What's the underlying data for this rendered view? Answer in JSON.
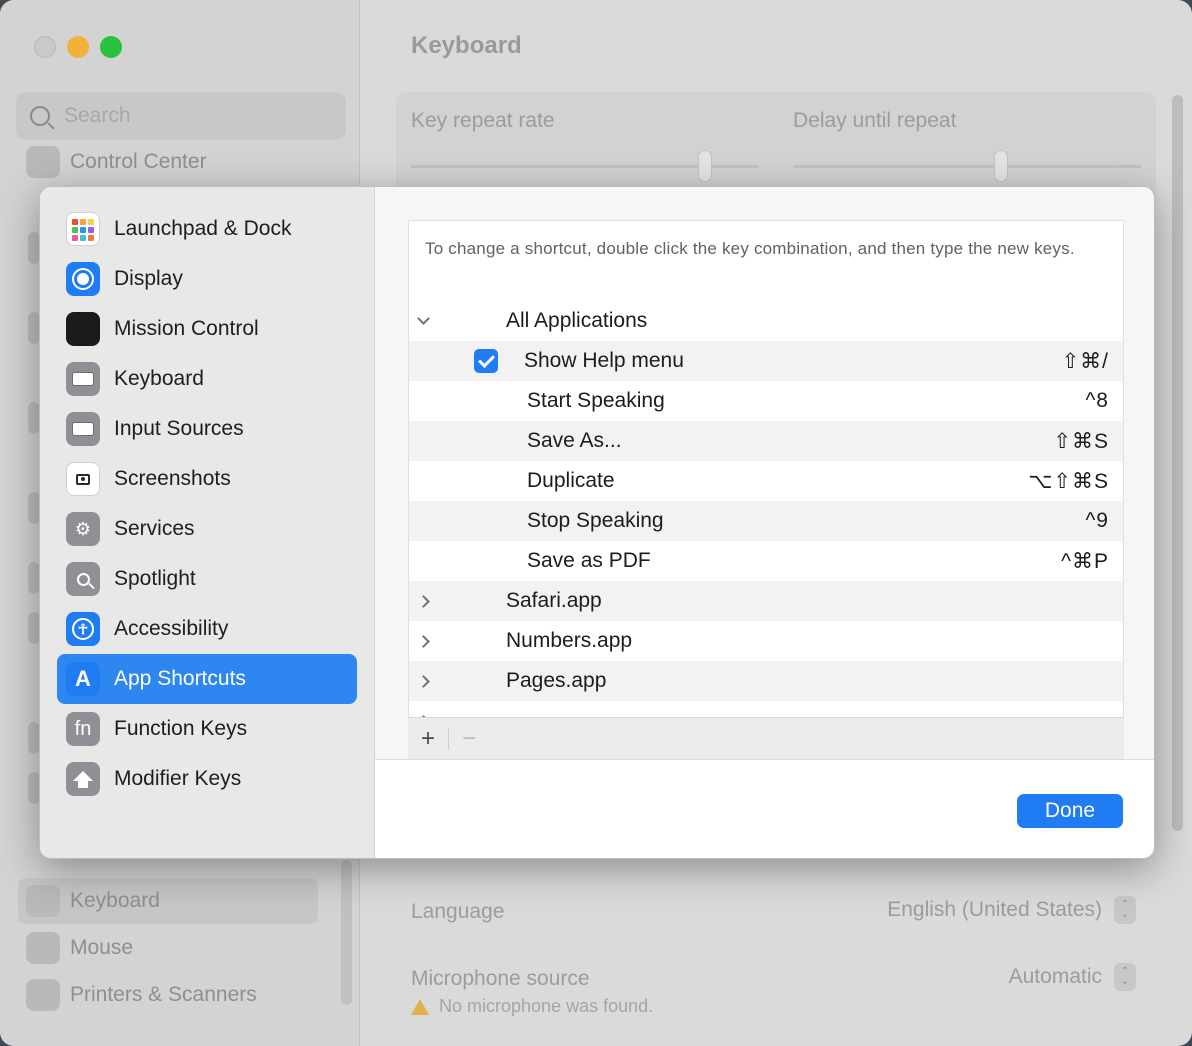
{
  "background": {
    "search_placeholder": "Search",
    "sidebar_top_item": "Control Center",
    "sidebar_bottom_items": [
      "Keyboard",
      "Mouse",
      "Printers & Scanners"
    ],
    "page_title": "Keyboard",
    "key_repeat_label": "Key repeat rate",
    "delay_label": "Delay until repeat",
    "language_label": "Language",
    "language_value": "English (United States)",
    "mic_label": "Microphone source",
    "mic_value": "Automatic",
    "mic_warning": "No microphone was found."
  },
  "sheet": {
    "sidebar": [
      {
        "label": "Launchpad & Dock",
        "icon": "launchpad-icon"
      },
      {
        "label": "Display",
        "icon": "display-icon"
      },
      {
        "label": "Mission Control",
        "icon": "mission-control-icon"
      },
      {
        "label": "Keyboard",
        "icon": "keyboard-icon"
      },
      {
        "label": "Input Sources",
        "icon": "input-sources-icon"
      },
      {
        "label": "Screenshots",
        "icon": "screenshots-icon"
      },
      {
        "label": "Services",
        "icon": "services-gear-icon"
      },
      {
        "label": "Spotlight",
        "icon": "spotlight-icon"
      },
      {
        "label": "Accessibility",
        "icon": "accessibility-icon"
      },
      {
        "label": "App Shortcuts",
        "icon": "app-shortcuts-icon"
      },
      {
        "label": "Function Keys",
        "icon": "function-keys-icon"
      },
      {
        "label": "Modifier Keys",
        "icon": "modifier-keys-icon"
      }
    ],
    "selected_item": "App Shortcuts",
    "hint": "To change a shortcut, double click the key combination, and then type the new keys.",
    "group_all": "All Applications",
    "shortcuts": [
      {
        "name": "Show Help menu",
        "keys": "⇧⌘/",
        "checked": true
      },
      {
        "name": "Start Speaking",
        "keys": "^8"
      },
      {
        "name": "Save As...",
        "keys": "⇧⌘S"
      },
      {
        "name": "Duplicate",
        "keys": "⌥⇧⌘S"
      },
      {
        "name": "Stop Speaking",
        "keys": "^9"
      },
      {
        "name": "Save as PDF",
        "keys": "^⌘P"
      }
    ],
    "apps": [
      "Safari.app",
      "Numbers.app",
      "Pages.app"
    ],
    "add_label": "+",
    "remove_label": "−",
    "done_label": "Done"
  },
  "colors": {
    "accent": "#2e86f0",
    "done_button": "#1f7cf2",
    "checkbox": "#1f7cf2"
  }
}
